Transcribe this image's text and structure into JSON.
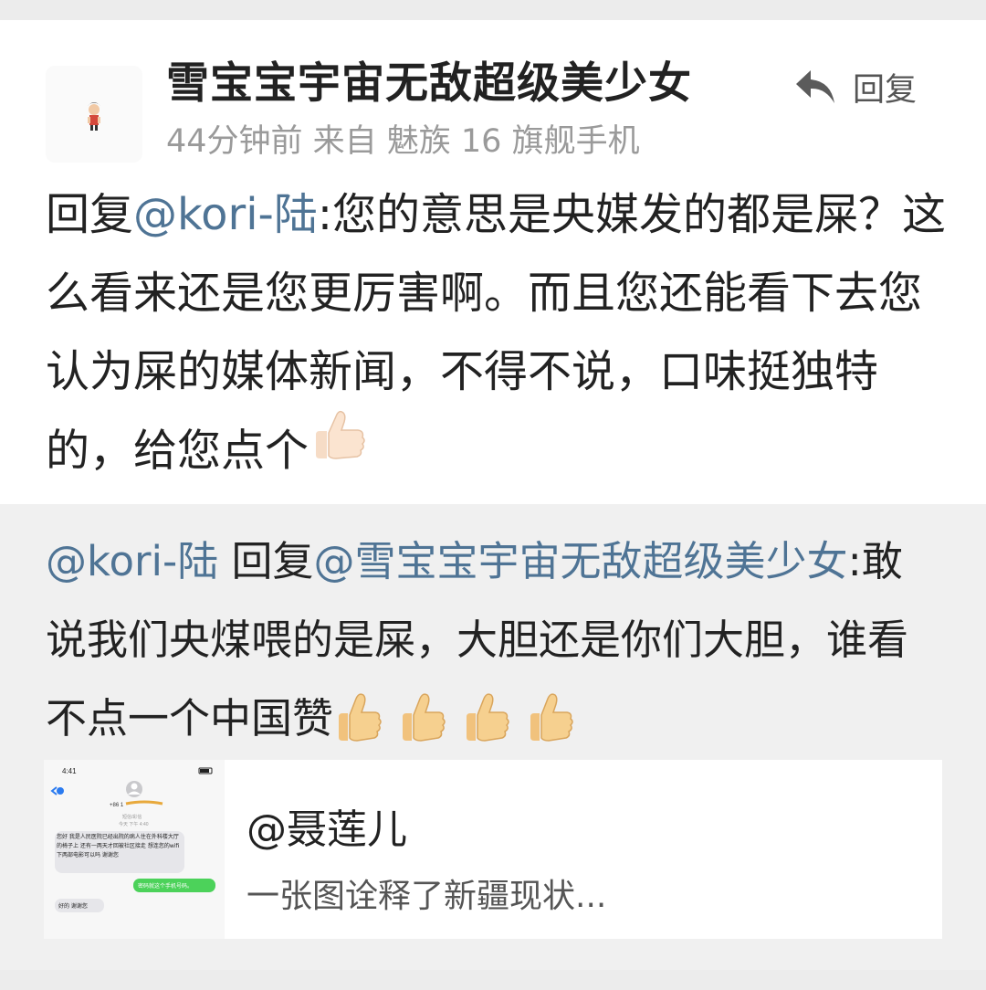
{
  "comment": {
    "username": "雪宝宝宇宙无敌超级美少女",
    "meta": "44分钟前 来自 魅族 16 旗舰手机",
    "reply_label": "回复",
    "content": {
      "prefix": "回复",
      "mention": "@kori-陆",
      "text": ":您的意思是央媒发的都是屎？这么看来还是您更厉害啊。而且您还能看下去您认为屎的媒体新闻，不得不说，口味挺独特的，给您点个"
    }
  },
  "quoted": {
    "author": "@kori-陆",
    "reply_word": " 回复",
    "mention": "@雪宝宝宇宙无敌超级美少女",
    "text": ":敢说我们央煤喂的是屎，大胆还是你们大胆，谁看不点一个中国赞",
    "thumbs_count": 4,
    "link_card": {
      "title": "@聂莲儿",
      "desc": "一张图诠释了新疆现状...",
      "thumbnail": {
        "time": "4:41",
        "number": "+86 1",
        "sub1": "短信/彩信",
        "sub2": "今天 下午 4:40",
        "bubble1": "您好 我是人民医院已经出院的病人住在外科楼大厅的椅子上  还有一两天才回被社区接走  想连您的wifi下两部电影可以吗 谢谢您",
        "bubble2": "密码就这个手机号码。",
        "bubble3": "好的 谢谢您"
      }
    }
  }
}
